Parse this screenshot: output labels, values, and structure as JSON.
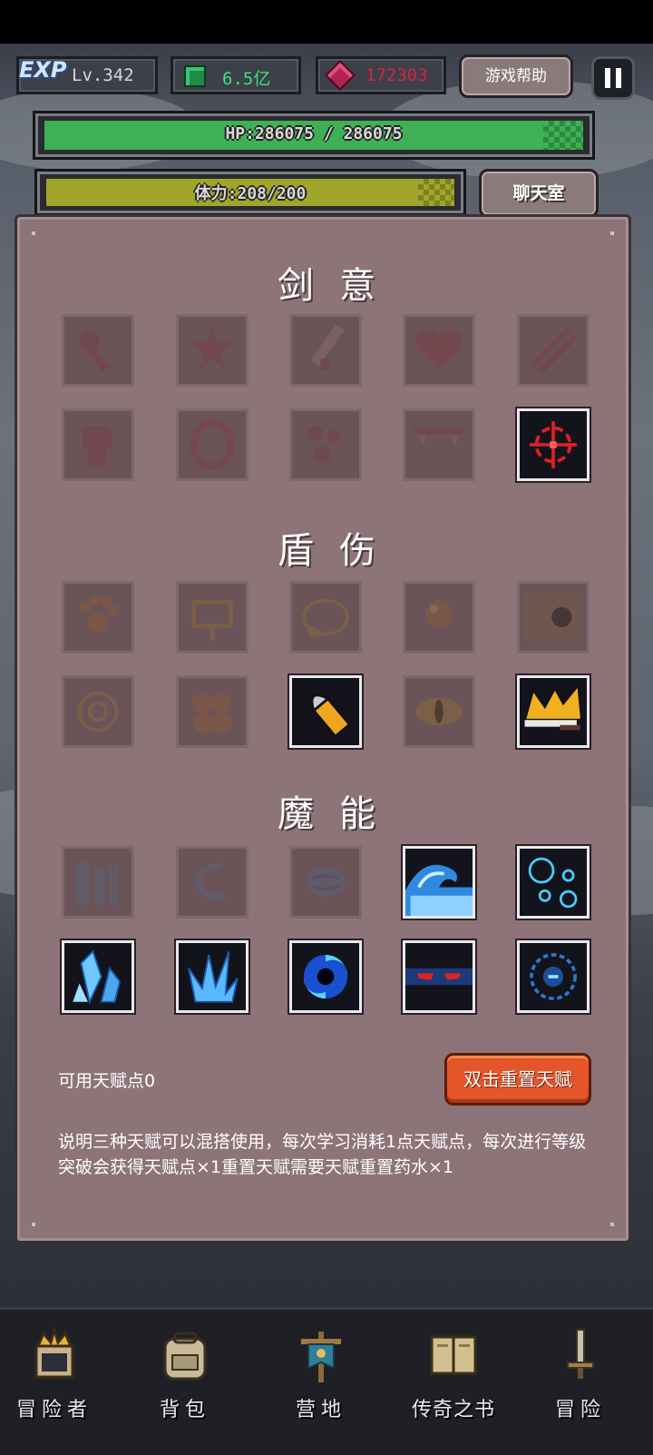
{
  "hud": {
    "exp_badge": "EXP",
    "level": "Lv.342",
    "gems": "6.5亿",
    "rubies": "172303",
    "help_label": "游戏帮助",
    "hp_text": "HP:286075 / 286075",
    "hp_fraction": 1.0,
    "stamina_text": "体力:208/200",
    "stamina_fraction": 1.0,
    "chat_label": "聊天室"
  },
  "talents": {
    "sections": [
      {
        "title": "剑意",
        "slots": [
          {
            "icon": "club-whip-icon",
            "unlocked": false
          },
          {
            "icon": "spiky-star-icon",
            "unlocked": false
          },
          {
            "icon": "sword-blade-icon",
            "unlocked": false
          },
          {
            "icon": "heart-icon",
            "unlocked": false
          },
          {
            "icon": "claw-slash-icon",
            "unlocked": false
          },
          {
            "icon": "fist-icon",
            "unlocked": false
          },
          {
            "icon": "ring-icon",
            "unlocked": false
          },
          {
            "icon": "blood-drops-icon",
            "unlocked": false
          },
          {
            "icon": "fangs-icon",
            "unlocked": false
          },
          {
            "icon": "crosshair-icon",
            "unlocked": true
          }
        ]
      },
      {
        "title": "盾伤",
        "slots": [
          {
            "icon": "paw-icon",
            "unlocked": false
          },
          {
            "icon": "signpost-icon",
            "unlocked": false
          },
          {
            "icon": "star-loop-icon",
            "unlocked": false
          },
          {
            "icon": "orb-bell-icon",
            "unlocked": false
          },
          {
            "icon": "cannonball-icon",
            "unlocked": false
          },
          {
            "icon": "target-coin-icon",
            "unlocked": false
          },
          {
            "icon": "boulders-icon",
            "unlocked": false
          },
          {
            "icon": "bullet-icon",
            "unlocked": true
          },
          {
            "icon": "dragon-eye-icon",
            "unlocked": false
          },
          {
            "icon": "golden-crown-icon",
            "unlocked": true
          }
        ]
      },
      {
        "title": "魔能",
        "slots": [
          {
            "icon": "pillars-icon",
            "unlocked": false
          },
          {
            "icon": "swirl-icon",
            "unlocked": false
          },
          {
            "icon": "brain-icon",
            "unlocked": false
          },
          {
            "icon": "wave-icon",
            "unlocked": true
          },
          {
            "icon": "bubbles-icon",
            "unlocked": true
          },
          {
            "icon": "ice-crystal-icon",
            "unlocked": true
          },
          {
            "icon": "ice-splash-icon",
            "unlocked": true
          },
          {
            "icon": "vortex-icon",
            "unlocked": true
          },
          {
            "icon": "ninja-eyes-icon",
            "unlocked": true
          },
          {
            "icon": "rune-circle-icon",
            "unlocked": true
          }
        ]
      }
    ],
    "points_label": "可用天赋点0",
    "reset_label": "双击重置天赋",
    "description": "说明三种天赋可以混搭使用，每次学习消耗1点天赋点，每次进行等级突破会获得天赋点×1重置天赋需要天赋重置药水×1"
  },
  "nav": [
    {
      "label": "冒险者",
      "icon": "crowned-helmet-icon"
    },
    {
      "label": "背包",
      "icon": "backpack-icon"
    },
    {
      "label": "营地",
      "icon": "camp-banner-icon"
    },
    {
      "label": "传奇之书",
      "icon": "legend-book-icon"
    },
    {
      "label": "冒险",
      "icon": "sword-icon"
    }
  ]
}
